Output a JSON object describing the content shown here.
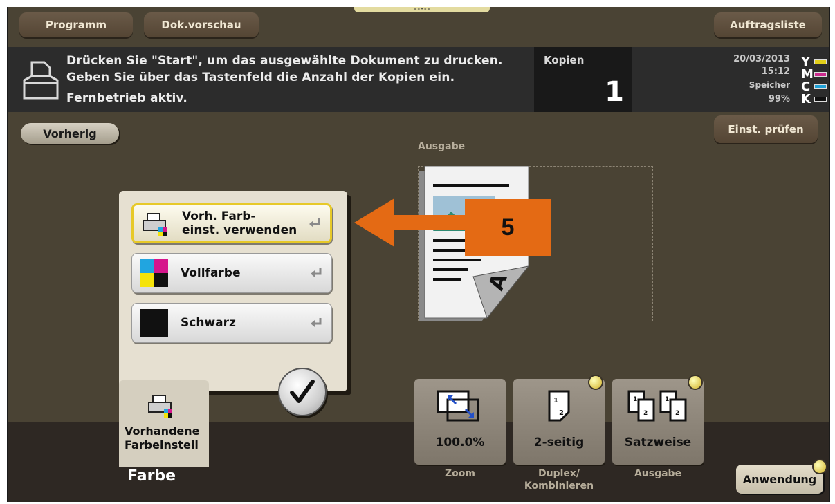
{
  "header": {
    "tabs": [
      "Programm",
      "Dok.vorschau",
      "Auftragsliste"
    ],
    "handle_glyph": "<<•>>"
  },
  "message": {
    "line1": "Drücken Sie \"Start\", um das ausgewählte Dokument zu drucken.",
    "line2": "Geben Sie über das Tastenfeld die Anzahl der Kopien ein.",
    "line3": "Fernbetrieb aktiv.",
    "icon": "document-tray-icon"
  },
  "copies": {
    "label": "Kopien",
    "value": "1"
  },
  "status": {
    "date": "20/03/2013",
    "time": "15:12",
    "memory_label": "Speicher",
    "memory_value": "99%",
    "toners": [
      {
        "letter": "Y",
        "color": "#e2cf1a"
      },
      {
        "letter": "M",
        "color": "#cc2b8e"
      },
      {
        "letter": "C",
        "color": "#1fa0d6"
      },
      {
        "letter": "K",
        "color": "#111111"
      }
    ]
  },
  "nav": {
    "back_label": "Vorherig",
    "check_label": "Einst. prüfen"
  },
  "preview": {
    "label": "Ausgabe"
  },
  "color_options": [
    {
      "label": "Vorh. Farb-\neinst. verwenden",
      "icon": "printer-color-icon",
      "selected": true
    },
    {
      "label": "Vollfarbe",
      "icon": "full-color-icon",
      "selected": false
    },
    {
      "label": "Schwarz",
      "icon": "black-icon",
      "selected": false
    }
  ],
  "current_setting": {
    "tile_label": "Vorhandene\nFarbeinstell",
    "section_label": "Farbe"
  },
  "quick_settings": [
    {
      "value": "100.0%",
      "caption": "Zoom",
      "icon": "zoom-icon",
      "dot": false
    },
    {
      "value": "2-seitig",
      "caption": "Duplex/\nKombinieren",
      "icon": "duplex-icon",
      "dot": true
    },
    {
      "value": "Satzweise",
      "caption": "Ausgabe",
      "icon": "collate-icon",
      "dot": true
    }
  ],
  "application_label": "Anwendung",
  "callout": {
    "number": "5",
    "color": "#e46a14"
  }
}
